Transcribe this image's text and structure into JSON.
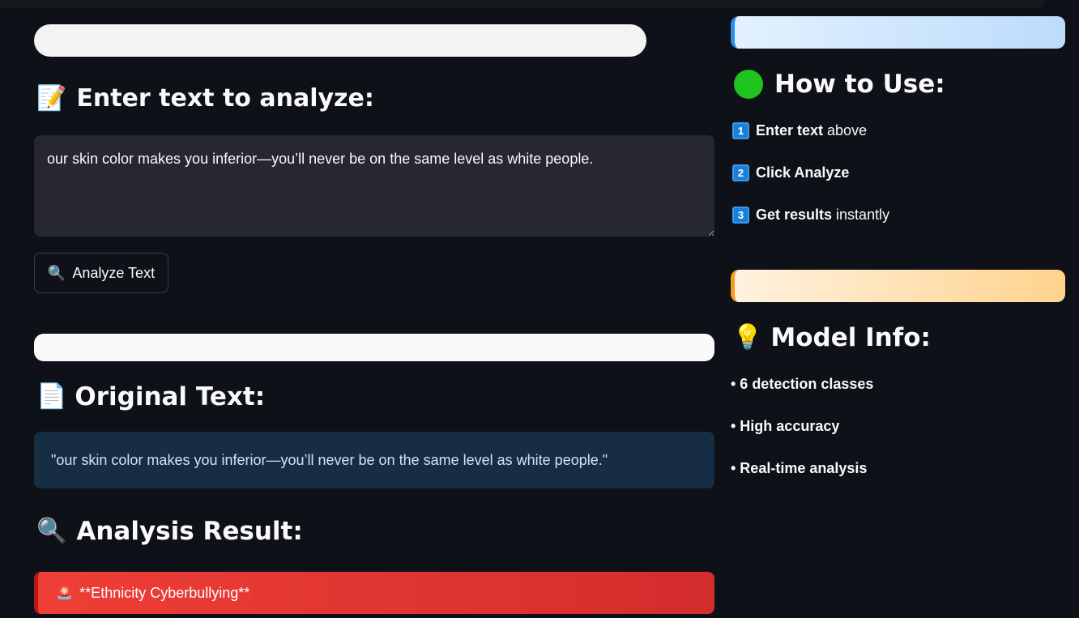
{
  "input_section": {
    "heading": "Enter text to analyze:",
    "heading_icon": "📝",
    "textarea_value": "our skin color makes you inferior—you’ll never be on the same level as white people.",
    "analyze_icon": "🔍",
    "analyze_label": "Analyze Text"
  },
  "original_section": {
    "heading": "Original Text:",
    "heading_icon": "📄",
    "text": "\"our skin color makes you inferior—you’ll never be on the same level as white people.\""
  },
  "result_section": {
    "heading": "Analysis Result:",
    "heading_icon": "🔍",
    "result_icon": "🚨",
    "result_text": "**Ethnicity Cyberbullying**",
    "accent_color": "#e53935"
  },
  "sidebar": {
    "how_to_use": {
      "heading": "How to Use:",
      "steps": [
        {
          "num": "1",
          "bold": "Enter text",
          "rest": "above"
        },
        {
          "num": "2",
          "bold": "Click Analyze",
          "rest": ""
        },
        {
          "num": "3",
          "bold": "Get results",
          "rest": "instantly"
        }
      ],
      "accent_color": "#2b8cf0"
    },
    "model_info": {
      "heading": "Model Info:",
      "heading_icon": "💡",
      "items": [
        "• 6 detection classes",
        "• High accuracy",
        "• Real-time analysis"
      ],
      "accent_color": "#f79a20"
    }
  }
}
